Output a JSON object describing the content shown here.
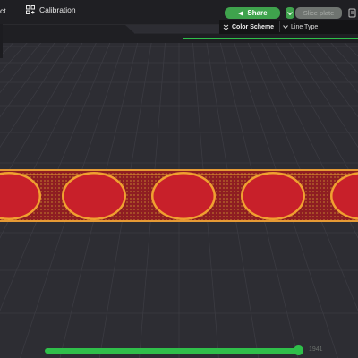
{
  "toolbar": {
    "left_fragment": "ct",
    "calibration_label": "Calibration",
    "share_label": "Share",
    "slice_label": "Slice plate"
  },
  "view_panel": {
    "color_scheme_label": "Color Scheme",
    "line_type_value": "Line Type"
  },
  "layer_slider": {
    "value_label": "1941",
    "fill_fraction": 0.96
  },
  "colors": {
    "accent_green": "#3fa34d",
    "print_red": "#c8202a",
    "print_outline": "#f0a030",
    "background": "#2d2d33"
  }
}
